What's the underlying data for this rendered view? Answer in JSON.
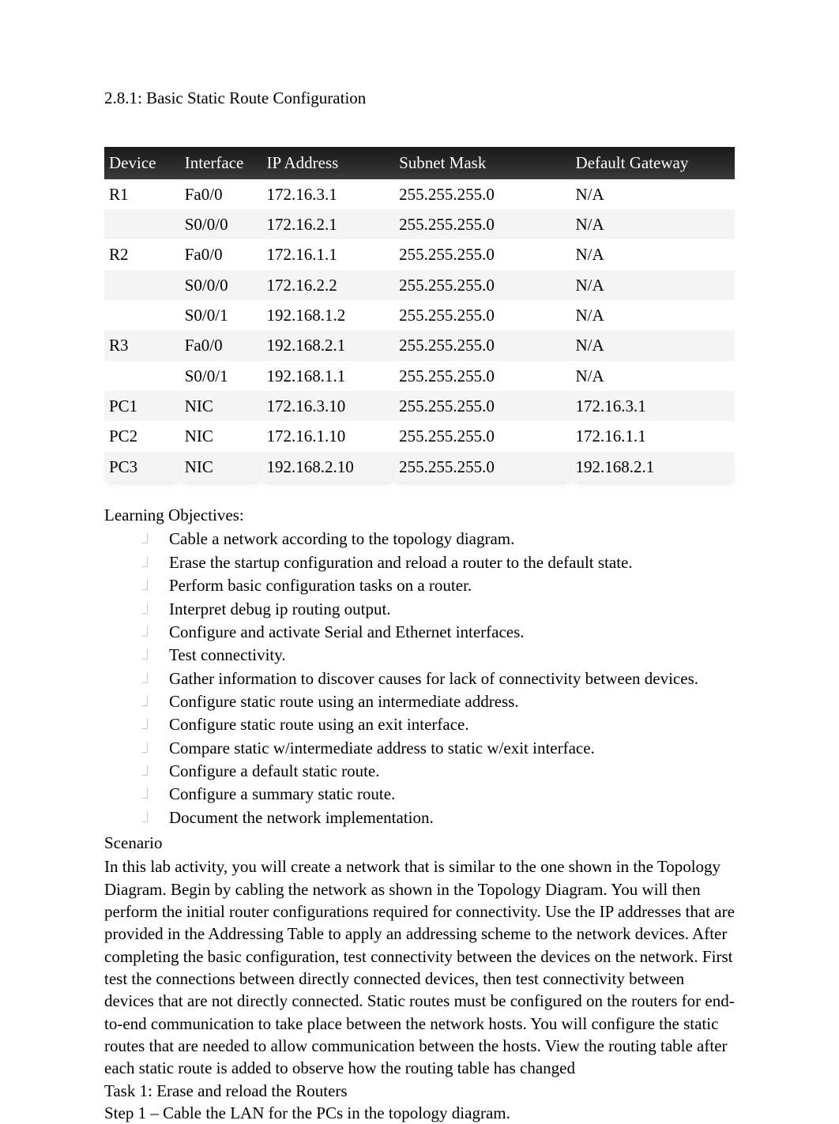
{
  "title": "2.8.1: Basic Static Route Configuration",
  "table": {
    "headers": [
      "Device",
      "Interface",
      "IP Address",
      "Subnet Mask",
      "Default Gateway"
    ],
    "rows": [
      {
        "device": "R1",
        "iface": "Fa0/0",
        "ip": "172.16.3.1",
        "mask": "255.255.255.0",
        "gw": "N/A"
      },
      {
        "device": "",
        "iface": "S0/0/0",
        "ip": "172.16.2.1",
        "mask": "255.255.255.0",
        "gw": "N/A"
      },
      {
        "device": "R2",
        "iface": "Fa0/0",
        "ip": "172.16.1.1",
        "mask": "255.255.255.0",
        "gw": "N/A"
      },
      {
        "device": "",
        "iface": "S0/0/0",
        "ip": "172.16.2.2",
        "mask": "255.255.255.0",
        "gw": "N/A"
      },
      {
        "device": "",
        "iface": "S0/0/1",
        "ip": "192.168.1.2",
        "mask": "255.255.255.0",
        "gw": "N/A"
      },
      {
        "device": "R3",
        "iface": "Fa0/0",
        "ip": "192.168.2.1",
        "mask": "255.255.255.0",
        "gw": "N/A"
      },
      {
        "device": "",
        "iface": "S0/0/1",
        "ip": "192.168.1.1",
        "mask": "255.255.255.0",
        "gw": "N/A"
      },
      {
        "device": "PC1",
        "iface": "NIC",
        "ip": "172.16.3.10",
        "mask": "255.255.255.0",
        "gw": "172.16.3.1"
      },
      {
        "device": "PC2",
        "iface": "NIC",
        "ip": "172.16.1.10",
        "mask": "255.255.255.0",
        "gw": "172.16.1.1"
      },
      {
        "device": "PC3",
        "iface": "NIC",
        "ip": "192.168.2.10",
        "mask": "255.255.255.0",
        "gw": "192.168.2.1"
      }
    ]
  },
  "objectives_heading": "Learning Objectives:",
  "objectives": [
    "Cable a network according to the topology diagram.",
    "Erase the startup configuration and reload a router to the default state.",
    "Perform basic configuration tasks on a router.",
    "Interpret debug ip routing output.",
    "Configure and activate Serial and Ethernet interfaces.",
    "Test connectivity.",
    "Gather information to discover causes for lack of connectivity between devices.",
    "Configure static route using an intermediate address.",
    "Configure static route using an exit interface.",
    "Compare static w/intermediate address to static w/exit interface.",
    "Configure a default static route.",
    "Configure a summary static route.",
    "Document the network implementation."
  ],
  "scenario_heading": "Scenario",
  "scenario_body": "In this lab activity, you will create a network that is similar to the one shown in the Topology Diagram. Begin by cabling the network as shown in the Topology Diagram. You will then perform the initial router configurations required for connectivity. Use the IP addresses that are provided in the Addressing Table to apply an addressing scheme to the network devices. After completing the basic configuration, test connectivity between the devices on the network. First test the connections between directly connected devices, then test connectivity between devices that are not directly connected. Static routes must be configured on the routers for end-to-end communication to take place between the network hosts. You will configure the static routes that are needed to allow communication between the hosts. View the routing table after each static route is added to observe how the routing table has changed",
  "task1": "Task 1: Erase and reload the Routers",
  "step1": "Step 1 – Cable the LAN for the PCs in the topology diagram."
}
